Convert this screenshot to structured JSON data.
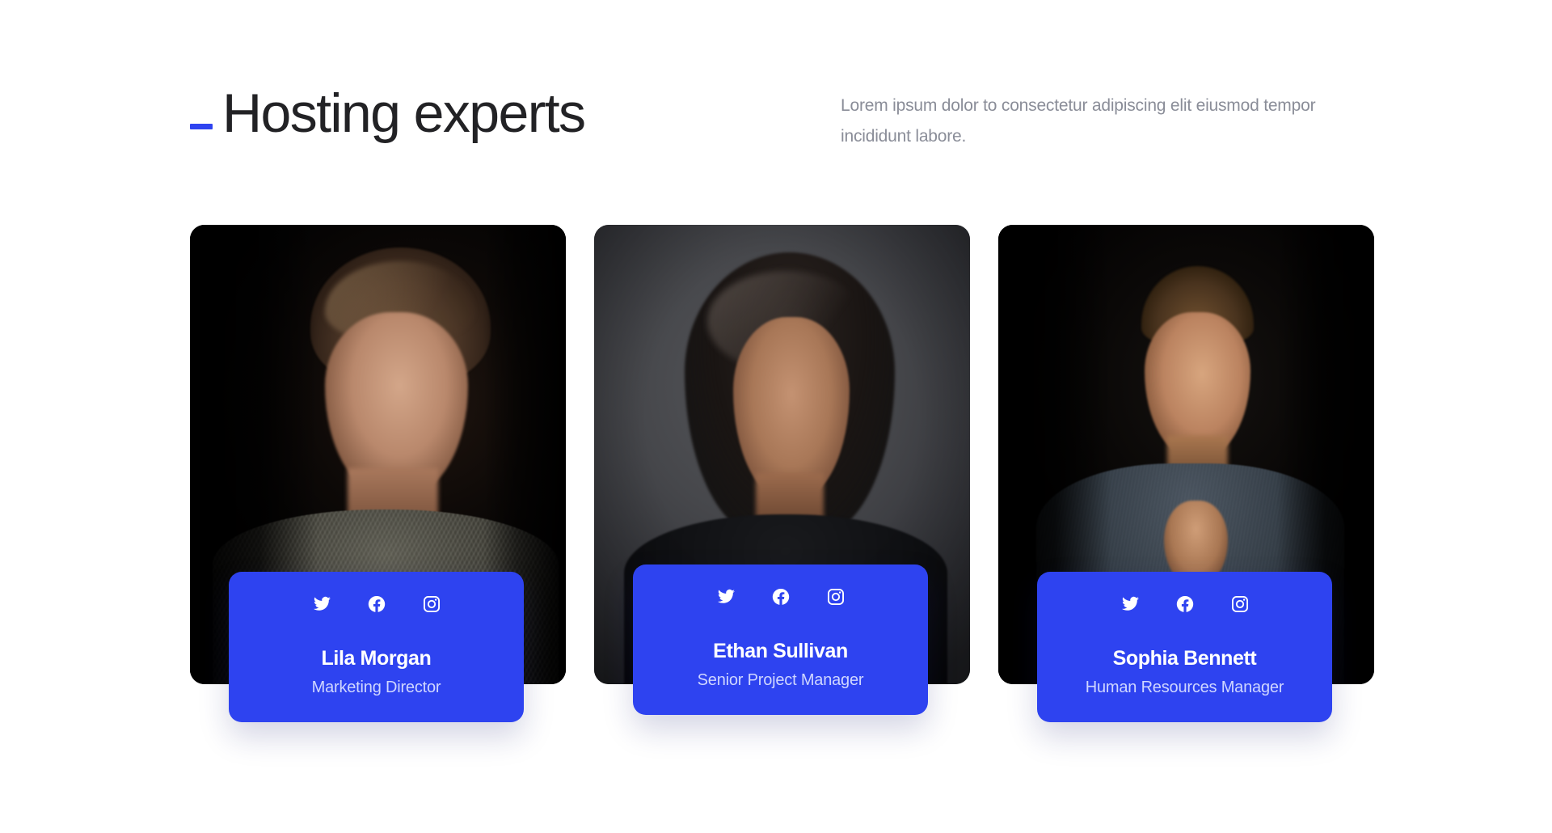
{
  "header": {
    "accent_color": "#2e43f0",
    "title": "Hosting experts",
    "intro": "Lorem ipsum dolor to consectetur adipiscing elit eiusmod tempor incididunt labore."
  },
  "theme": {
    "brand_blue": "#2e43f0",
    "page_background": "#ffffff",
    "title_color": "#222225",
    "intro_color": "#8a8d98",
    "role_color": "#cfd6ff"
  },
  "social_links": [
    {
      "name": "twitter-icon",
      "label": "Twitter"
    },
    {
      "name": "facebook-icon",
      "label": "Facebook"
    },
    {
      "name": "instagram-icon",
      "label": "Instagram"
    }
  ],
  "team": [
    {
      "name": "Lila Morgan",
      "role": "Marketing Director",
      "photo_alt": "Portrait of Lila Morgan on a black background"
    },
    {
      "name": "Ethan Sullivan",
      "role": "Senior Project Manager",
      "photo_alt": "Portrait of Ethan Sullivan on a grey background"
    },
    {
      "name": "Sophia Bennett",
      "role": "Human Resources Manager",
      "photo_alt": "Portrait of Sophia Bennett on a black background"
    }
  ]
}
